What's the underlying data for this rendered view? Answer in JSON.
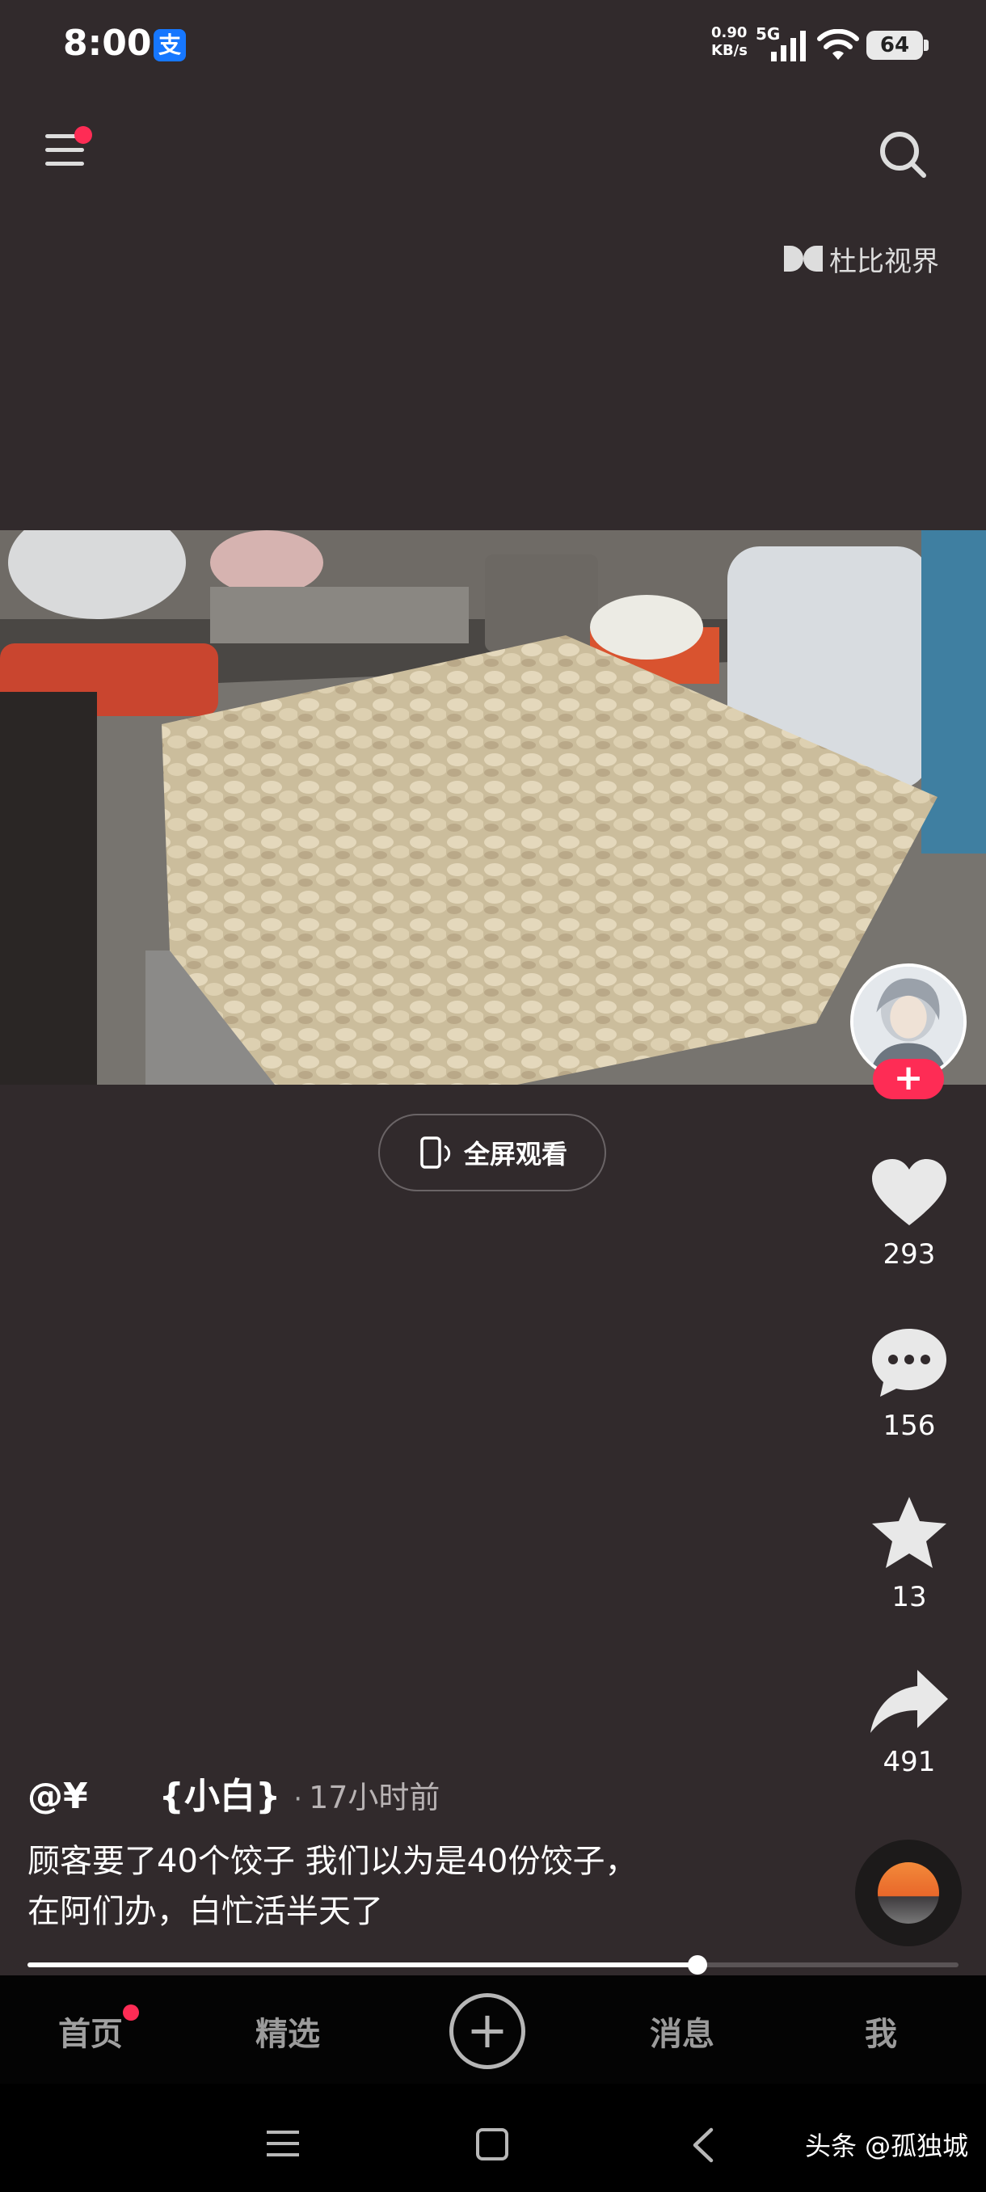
{
  "status_bar": {
    "time": "8:00",
    "app_badge": "支",
    "net_speed_value": "0.90",
    "net_speed_unit": "KB/s",
    "network": "5G",
    "battery": "64"
  },
  "top_bar": {
    "dolby_label": "杜比视界"
  },
  "video": {
    "fullscreen_label": "全屏观看"
  },
  "actions": {
    "likes": "293",
    "comments": "156",
    "favorites": "13",
    "shares": "491",
    "follow_symbol": "+"
  },
  "post": {
    "author": "@¥　　{小白}",
    "separator": "·",
    "time": "17小时前",
    "caption_line1": "顾客要了40个饺子 我们以为是40份饺子，",
    "caption_line2": "在阿们办，白忙活半天了",
    "progress": 0.72
  },
  "bottom_nav": {
    "home": "首页",
    "featured": "精选",
    "plus": "+",
    "messages": "消息",
    "me": "我"
  },
  "watermark": "头条 @孤独城"
}
